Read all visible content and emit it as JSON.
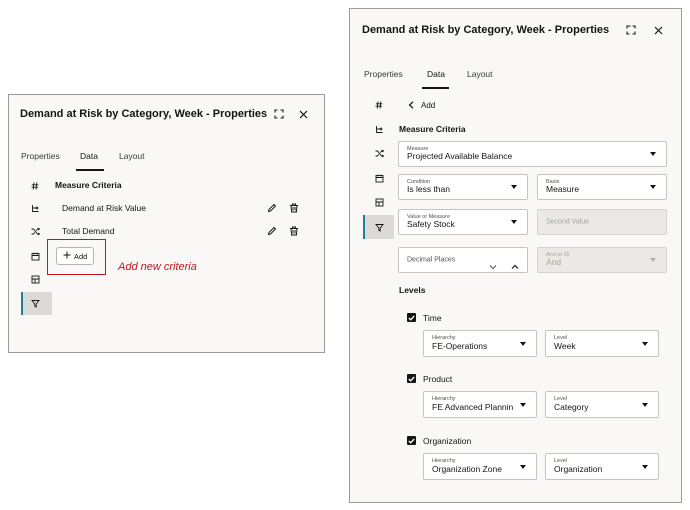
{
  "left_panel": {
    "title": "Demand at Risk by Category, Week - Properties",
    "tabs": [
      "Properties",
      "Data",
      "Layout"
    ],
    "section": "Measure Criteria",
    "criteria": [
      "Demand at Risk Value",
      "Total Demand"
    ],
    "add_label": "Add",
    "annotation": "Add new criteria"
  },
  "right_panel": {
    "title": "Demand at Risk by Category, Week - Properties",
    "tabs": [
      "Properties",
      "Data",
      "Layout"
    ],
    "back_label": "Add",
    "section": "Measure Criteria",
    "measure": {
      "label": "Measure",
      "value": "Projected Available Balance"
    },
    "condition": {
      "label": "Condition",
      "value": "Is less than"
    },
    "basis": {
      "label": "Basis",
      "value": "Measure"
    },
    "value_or_measure": {
      "label": "Value or Measure",
      "value": "Safety Stock"
    },
    "second_value": {
      "placeholder": "Second Value"
    },
    "decimal_places": {
      "placeholder": "Decimal Places"
    },
    "and_or": {
      "label": "And or Or",
      "value": "And"
    },
    "levels_title": "Levels",
    "levels": [
      {
        "name": "Time",
        "hierarchy_label": "Hierarchy",
        "hierarchy": "FE-Operations",
        "level_label": "Level",
        "level": "Week"
      },
      {
        "name": "Product",
        "hierarchy_label": "Hierarchy",
        "hierarchy": "FE Advanced Plannin",
        "level_label": "Level",
        "level": "Category"
      },
      {
        "name": "Organization",
        "hierarchy_label": "Hierarchy",
        "hierarchy": "Organization Zone",
        "level_label": "Level",
        "level": "Organization"
      }
    ]
  },
  "colors": {
    "annotation": "#c0161c",
    "accent": "#227e9e",
    "panel_bg": "#f9f8f6"
  }
}
